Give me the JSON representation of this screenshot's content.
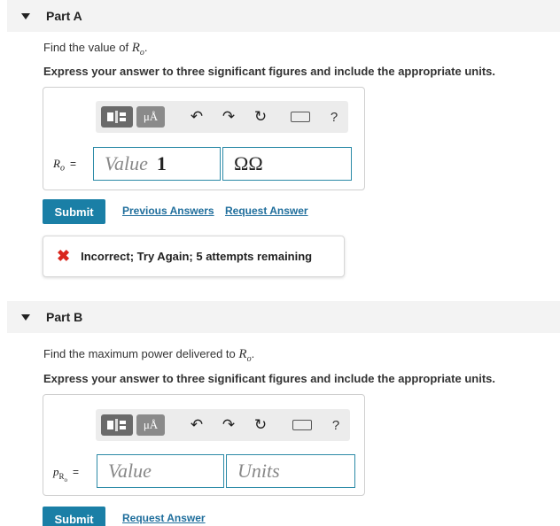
{
  "partA": {
    "header": "Part A",
    "prompt_prefix": "Find the value of",
    "prompt_var": "R",
    "prompt_var_sub": "o",
    "prompt_suffix": ".",
    "instruction": "Express your answer to three significant figures and include the appropriate units.",
    "toolbar": {
      "mu_label": "μÅ",
      "help_label": "?"
    },
    "var_label": "R",
    "var_sub": "o",
    "equals": "=",
    "value_placeholder": "Value",
    "value_entered": "1",
    "unit_entered": "ΩΩ",
    "submit_label": "Submit",
    "previous_answers_label": "Previous Answers",
    "request_answer_label": "Request Answer",
    "feedback_icon": "✖",
    "feedback_text": "Incorrect; Try Again; 5 attempts remaining"
  },
  "partB": {
    "header": "Part B",
    "prompt_prefix": "Find the maximum power delivered to",
    "prompt_var": "R",
    "prompt_var_sub": "o",
    "prompt_suffix": ".",
    "instruction": "Express your answer to three significant figures and include the appropriate units.",
    "toolbar": {
      "mu_label": "μÅ",
      "help_label": "?"
    },
    "var_label": "p",
    "var_sub": "R",
    "var_sub2": "o",
    "equals": "=",
    "value_placeholder": "Value",
    "units_placeholder": "Units",
    "submit_label": "Submit",
    "request_answer_label": "Request Answer"
  },
  "icons": {
    "undo": "↶",
    "redo": "↷",
    "reset": "↻"
  },
  "colors": {
    "accent": "#1a7fa6",
    "link": "#1f6e9c",
    "error": "#d9261c",
    "field_border": "#2b8aa7"
  }
}
